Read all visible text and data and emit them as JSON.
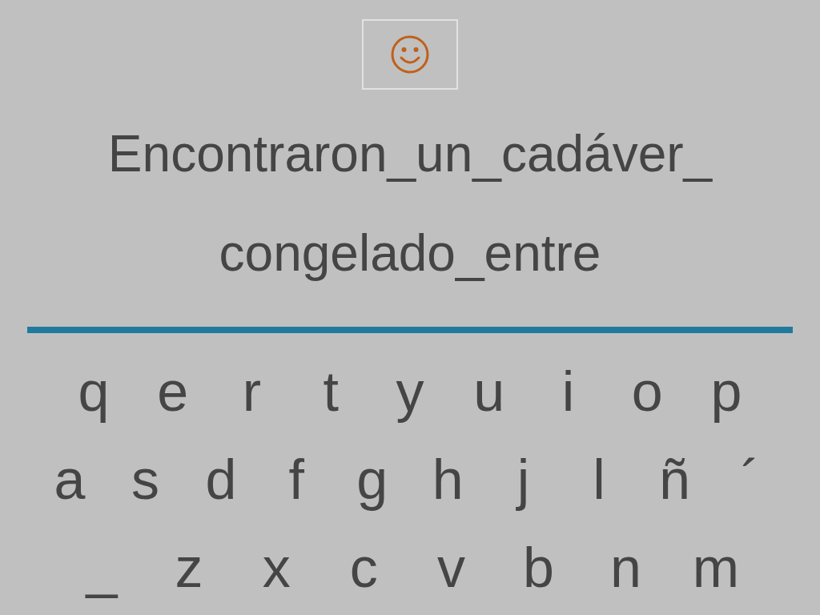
{
  "sentence_lines": [
    "Encontraron_un_cadáver_",
    "congelado_entre"
  ],
  "keyboard_rows": [
    [
      "q",
      "e",
      "r",
      "t",
      "y",
      "u",
      "i",
      "o",
      "p"
    ],
    [
      "a",
      "s",
      "d",
      "f",
      "g",
      "h",
      "j",
      "l",
      "ñ",
      "´"
    ],
    [
      "_",
      "z",
      "x",
      "c",
      "v",
      "b",
      "n",
      "m"
    ]
  ]
}
